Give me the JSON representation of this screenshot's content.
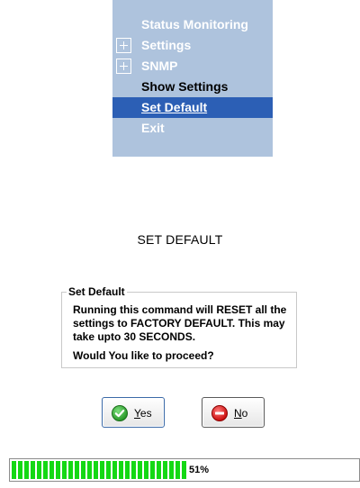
{
  "menu": {
    "items": [
      {
        "label": "Status Monitoring",
        "expander": false,
        "selected": false
      },
      {
        "label": "Settings",
        "expander": true,
        "selected": false
      },
      {
        "label": "SNMP",
        "expander": true,
        "selected": false
      },
      {
        "label": "Show Settings",
        "expander": false,
        "selected": false
      },
      {
        "label": "Set Default",
        "expander": false,
        "selected": true
      },
      {
        "label": "Exit",
        "expander": false,
        "selected": false
      }
    ]
  },
  "page": {
    "title": "SET DEFAULT"
  },
  "dialog": {
    "group_title": "Set Default",
    "message": "Running this command will RESET all the settings to FACTORY DEFAULT. This may take upto 30 SECONDS.",
    "question": "Would You like to proceed?"
  },
  "buttons": {
    "yes_mnemonic": "Y",
    "yes_rest": "es",
    "yes_icon": "check-circle-icon",
    "no_mnemonic": "N",
    "no_rest": "o",
    "no_icon": "minus-circle-icon"
  },
  "progress": {
    "percent": 51,
    "text": "51%"
  },
  "colors": {
    "menu_background": "#aec3dd",
    "menu_selected": "#2c5fb5",
    "progress_fill": "#14d814"
  }
}
